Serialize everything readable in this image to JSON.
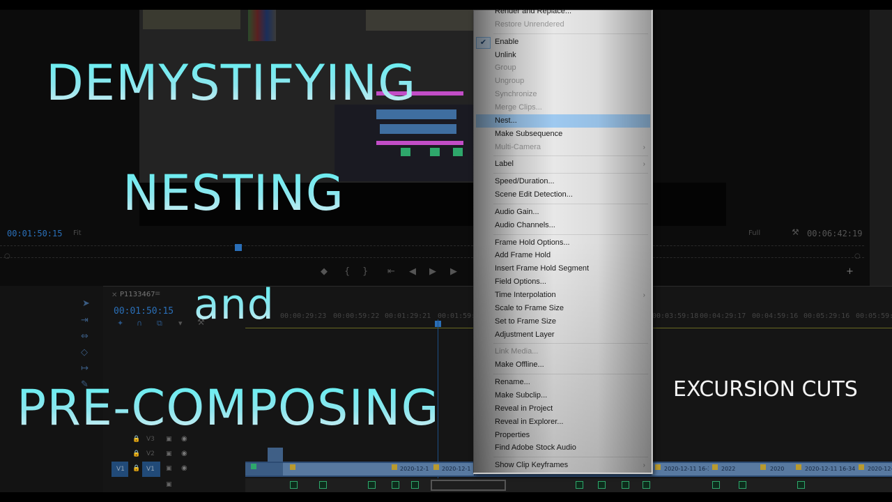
{
  "overlay": {
    "line1": "DEMYSTIFYING",
    "line2": "NESTING",
    "line3": "and",
    "line4": "PRE-COMPOSING",
    "brand": "EXCURSION CUTS",
    "accent_color": "#5ff0f2"
  },
  "source_monitor": {
    "timecode": "00:01:50:15",
    "fit": "Fit"
  },
  "program_monitor": {
    "zoom": "Full",
    "timecode": "00:06:42:19"
  },
  "timeline": {
    "sequence_name": "P1133467",
    "timecode": "00:01:50:15",
    "ruler_labels": [
      "00:00:29:23",
      "00:00:59:22",
      "00:01:29:21",
      "00:01:59:21",
      "00:03:59:18",
      "00:04:29:17",
      "00:04:59:16",
      "00:05:29:16",
      "00:05:59:15"
    ],
    "tracks": [
      {
        "name": "V3"
      },
      {
        "name": "V2"
      },
      {
        "name": "V1",
        "source": "V1"
      }
    ],
    "clip_labels": [
      "2020-12-1",
      "2020-12-1",
      "2020-12-11 16-34-1",
      "2020-12-11 16-34-1",
      "2020-12-11 16-34-5",
      "2022",
      "2020"
    ]
  },
  "context_menu": {
    "items": [
      {
        "label": "Render and Replace...",
        "enabled": true
      },
      {
        "label": "Restore Unrendered",
        "enabled": false
      },
      {
        "separator": true
      },
      {
        "label": "Enable",
        "enabled": true,
        "checked": true
      },
      {
        "label": "Unlink",
        "enabled": true
      },
      {
        "label": "Group",
        "enabled": false
      },
      {
        "label": "Ungroup",
        "enabled": false
      },
      {
        "label": "Synchronize",
        "enabled": false
      },
      {
        "label": "Merge Clips...",
        "enabled": false
      },
      {
        "label": "Nest...",
        "enabled": true,
        "highlighted": true
      },
      {
        "label": "Make Subsequence",
        "enabled": true
      },
      {
        "label": "Multi-Camera",
        "enabled": false,
        "submenu": true
      },
      {
        "separator": true
      },
      {
        "label": "Label",
        "enabled": true,
        "submenu": true
      },
      {
        "separator": true
      },
      {
        "label": "Speed/Duration...",
        "enabled": true
      },
      {
        "label": "Scene Edit Detection...",
        "enabled": true
      },
      {
        "separator": true
      },
      {
        "label": "Audio Gain...",
        "enabled": true
      },
      {
        "label": "Audio Channels...",
        "enabled": true
      },
      {
        "separator": true
      },
      {
        "label": "Frame Hold Options...",
        "enabled": true
      },
      {
        "label": "Add Frame Hold",
        "enabled": true
      },
      {
        "label": "Insert Frame Hold Segment",
        "enabled": true
      },
      {
        "label": "Field Options...",
        "enabled": true
      },
      {
        "label": "Time Interpolation",
        "enabled": true,
        "submenu": true
      },
      {
        "label": "Scale to Frame Size",
        "enabled": true
      },
      {
        "label": "Set to Frame Size",
        "enabled": true
      },
      {
        "label": "Adjustment Layer",
        "enabled": true
      },
      {
        "separator": true
      },
      {
        "label": "Link Media...",
        "enabled": false
      },
      {
        "label": "Make Offline...",
        "enabled": true
      },
      {
        "separator": true
      },
      {
        "label": "Rename...",
        "enabled": true
      },
      {
        "label": "Make Subclip...",
        "enabled": true
      },
      {
        "label": "Reveal in Project",
        "enabled": true
      },
      {
        "label": "Reveal in Explorer...",
        "enabled": true
      },
      {
        "label": "Properties",
        "enabled": true
      },
      {
        "label": "Find Adobe Stock Audio",
        "enabled": true
      },
      {
        "separator": true
      },
      {
        "label": "Show Clip Keyframes",
        "enabled": true,
        "submenu": true
      }
    ],
    "colors": {
      "background": "#e8e8e8",
      "highlight": "#9ec9f0",
      "disabled_text": "#9a9a9a"
    }
  }
}
